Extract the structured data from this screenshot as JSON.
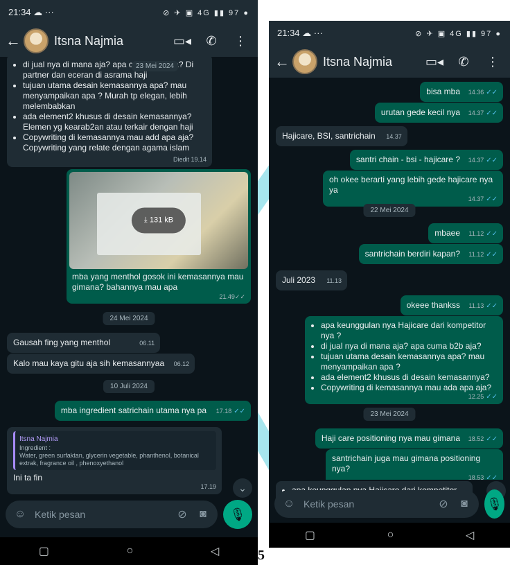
{
  "page_number": "5",
  "left": {
    "status": {
      "time": "21:34",
      "extras": "☁ ···",
      "icons": "⊘ ✈ ▣ 4G ▮▮ 97 ●"
    },
    "header": {
      "contact_name": "Itsna Najmia"
    },
    "messages": {
      "q_top": [
        "di jual nya di mana aja? apa cuma b2b aja? Di partner dan eceran di asrama haji",
        "tujuan utama desain kemasannya apa? mau menyampaikan apa ? Murah tp elegan, lebih melembabkan",
        "ada element2 khusus di desain kemasannya? Elemen yg kearab2an atau terkair dengan haji",
        "Copywriting di kemasannya mau add apa aja? Copywriting yang relate dengan agama islam"
      ],
      "q_top_date_overlay": "23 Mei 2024",
      "q_top_meta": "Diedit 19.14",
      "media_size": "131 kB",
      "media_caption": "mba yang menthol gosok ini kemasannya mau gimana? bahannya mau apa",
      "media_time": "21.49",
      "date_24mei": "24 Mei 2024",
      "m1_text": "Gausah fing yang menthol",
      "m1_time": "06.11",
      "m2_text": "Kalo mau kaya gitu aja sih kemasannyaa",
      "m2_time": "06.12",
      "date_10juli": "10 Juli 2024",
      "m3_text": "mba ingredient satrichain utama nya pa",
      "m3_time": "17.18",
      "reply_author": "Itsna Najmia",
      "reply_quote": "Ingredient :\nWater, green surfaktan, glycerin vegetable, phanthenol, botanical extrak, fragrance oil , phenoxyethanol",
      "reply_text": "Ini ta fin",
      "reply_time": "17.19"
    },
    "composer": {
      "placeholder": "Ketik pesan"
    }
  },
  "right": {
    "status": {
      "time": "21:34",
      "extras": "☁ ···",
      "icons": "⊘ ✈ ▣ 4G ▮▮ 97 ●"
    },
    "header": {
      "contact_name": "Itsna Najmia"
    },
    "messages": {
      "r1_text": "bisa mba",
      "r1_time": "14.36",
      "r2_text": "urutan gede kecil nya",
      "r2_time": "14.37",
      "r3_text": "Hajicare, BSI, santrichain",
      "r3_time": "14.37",
      "r4_text": "santri chain - bsi - hajicare ?",
      "r4_time": "14.37",
      "r5_text": "oh okee berarti yang lebih gede hajicare nya ya",
      "r5_time": "14.37",
      "date_22mei": "22 Mei 2024",
      "r6_text": "mbaee",
      "r6_time": "11.12",
      "r7_text": "santrichain berdiri kapan?",
      "r7_time": "11.12",
      "r8_text": "Juli 2023",
      "r8_time": "11.13",
      "r9_text": "okeee thankss",
      "r9_time": "11.13",
      "q_list": [
        "apa keunggulan nya Hajicare dari kompetitor nya ?",
        "di jual nya di mana aja? apa cuma b2b aja?",
        "tujuan utama desain kemasannya apa? mau menyampaikan apa ?",
        "ada element2 khusus di desain kemasannya?",
        "Copywriting di kemasannya mau ada apa aja?"
      ],
      "q_list_time": "12.25",
      "date_23mei": "23 Mei 2024",
      "r10_text": "Haji care positioning nya mau gimana",
      "r10_time": "18.52",
      "r11_text": "santrichain juga mau gimana positioning nya?",
      "r11_time": "18.53",
      "partial_text": "apa keunggulan nya Hajicare dari kompetitor nya ? Lebih murah, elegan, lebih melembabkan"
    },
    "composer": {
      "placeholder": "Ketik pesan"
    }
  }
}
